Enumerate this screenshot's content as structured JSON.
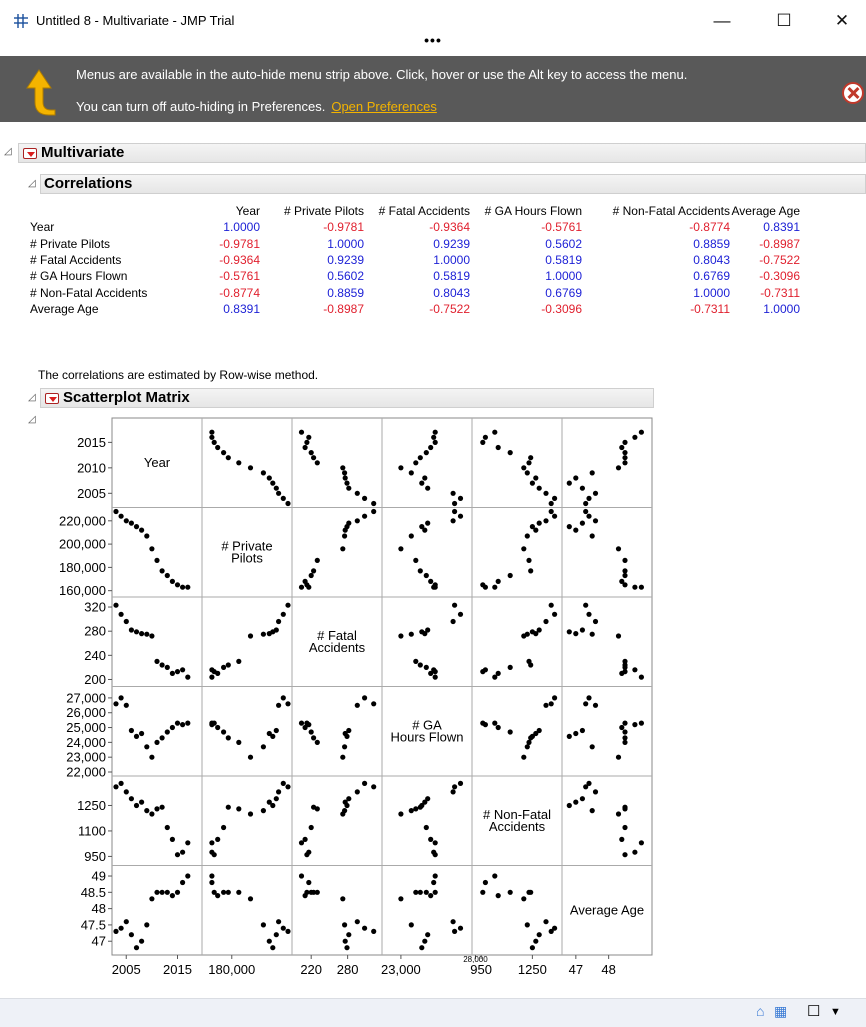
{
  "window": {
    "title": "Untitled 8 - Multivariate - JMP Trial",
    "minimize": "—",
    "maximize": "☐",
    "close": "✕",
    "overflow": "•••"
  },
  "banner": {
    "line1": "Menus are available in the auto-hide menu strip above. Click, hover or use the Alt key to access the menu.",
    "line2": "You can turn off auto-hiding in Preferences.",
    "link": "Open Preferences"
  },
  "report": {
    "title": "Multivariate",
    "correlations": {
      "title": "Correlations",
      "columns": [
        "Year",
        "# Private Pilots",
        "# Fatal Accidents",
        "# GA Hours Flown",
        "# Non-Fatal Accidents",
        "Average Age"
      ],
      "rows": [
        {
          "label": "Year",
          "values": [
            "1.0000",
            "-0.9781",
            "-0.9364",
            "-0.5761",
            "-0.8774",
            "0.8391"
          ]
        },
        {
          "label": "# Private Pilots",
          "values": [
            "-0.9781",
            "1.0000",
            "0.9239",
            "0.5602",
            "0.8859",
            "-0.8987"
          ]
        },
        {
          "label": "# Fatal Accidents",
          "values": [
            "-0.9364",
            "0.9239",
            "1.0000",
            "0.5819",
            "0.8043",
            "-0.7522"
          ]
        },
        {
          "label": "# GA Hours Flown",
          "values": [
            "-0.5761",
            "0.5602",
            "0.5819",
            "1.0000",
            "0.6769",
            "-0.3096"
          ]
        },
        {
          "label": "# Non-Fatal Accidents",
          "values": [
            "-0.8774",
            "0.8859",
            "0.8043",
            "0.6769",
            "1.0000",
            "-0.7311"
          ]
        },
        {
          "label": "Average Age",
          "values": [
            "0.8391",
            "-0.8987",
            "-0.7522",
            "-0.3096",
            "-0.7311",
            "1.0000"
          ]
        }
      ],
      "note": "The correlations are estimated by Row-wise method."
    },
    "scatterplot": {
      "title": "Scatterplot Matrix",
      "diagonal_labels": [
        [
          "Year"
        ],
        [
          "# Private",
          "Pilots"
        ],
        [
          "# Fatal",
          "Accidents"
        ],
        [
          "# GA",
          "Hours Flown"
        ],
        [
          "# Non-Fatal",
          "Accidents"
        ],
        [
          "Average Age"
        ]
      ],
      "y_ticks": [
        [
          {
            "v": 2015,
            "t": "2015"
          },
          {
            "v": 2010,
            "t": "2010"
          },
          {
            "v": 2005,
            "t": "2005"
          }
        ],
        [
          {
            "v": 220000,
            "t": "220,000"
          },
          {
            "v": 200000,
            "t": "200,000"
          },
          {
            "v": 180000,
            "t": "180,000"
          },
          {
            "v": 160000,
            "t": "160,000"
          }
        ],
        [
          {
            "v": 320,
            "t": "320"
          },
          {
            "v": 280,
            "t": "280"
          },
          {
            "v": 240,
            "t": "240"
          },
          {
            "v": 200,
            "t": "200"
          }
        ],
        [
          {
            "v": 27000,
            "t": "27,000"
          },
          {
            "v": 26000,
            "t": "26,000"
          },
          {
            "v": 25000,
            "t": "25,000"
          },
          {
            "v": 24000,
            "t": "24,000"
          },
          {
            "v": 23000,
            "t": "23,000"
          },
          {
            "v": 22000,
            "t": "22,000"
          }
        ],
        [
          {
            "v": 1250,
            "t": "1250"
          },
          {
            "v": 1100,
            "t": "1100"
          },
          {
            "v": 950,
            "t": "950"
          }
        ],
        [
          {
            "v": 49,
            "t": "49"
          },
          {
            "v": 48.5,
            "t": "48.5"
          },
          {
            "v": 48,
            "t": "48"
          },
          {
            "v": 47.5,
            "t": "47.5"
          },
          {
            "v": 47,
            "t": "47"
          }
        ]
      ],
      "x_ticks": [
        [
          {
            "v": 2005,
            "t": "2005"
          },
          {
            "v": 2015,
            "t": "2015"
          }
        ],
        [
          {
            "v": 180000,
            "t": "180,000"
          }
        ],
        [
          {
            "v": 220,
            "t": "220"
          },
          {
            "v": 280,
            "t": "280"
          }
        ],
        [
          {
            "v": 23000,
            "t": "23,000"
          },
          {
            "v": 28000,
            "t": "28,000"
          }
        ],
        [
          {
            "v": 950,
            "t": "950"
          },
          {
            "v": 1250,
            "t": "1250"
          }
        ],
        [
          {
            "v": 47,
            "t": "47"
          },
          {
            "v": 48,
            "t": "48"
          }
        ]
      ]
    }
  },
  "chart_data": {
    "type": "scatter",
    "title": "Scatterplot Matrix",
    "variables": [
      "Year",
      "# Private Pilots",
      "# Fatal Accidents",
      "# GA Hours Flown",
      "# Non-Fatal Accidents",
      "Average Age"
    ],
    "ranges": [
      [
        2003,
        2019
      ],
      [
        158000,
        228000
      ],
      [
        195,
        330
      ],
      [
        22000,
        27500
      ],
      [
        920,
        1400
      ],
      [
        46.7,
        49.2
      ]
    ],
    "observations": [
      [
        2003,
        228000,
        323,
        26600,
        1360,
        47.3
      ],
      [
        2004,
        224000,
        308,
        27000,
        1380,
        47.4
      ],
      [
        2005,
        220000,
        296,
        26500,
        1330,
        47.6
      ],
      [
        2006,
        218000,
        282,
        24800,
        1290,
        47.2
      ],
      [
        2007,
        215000,
        279,
        24400,
        1250,
        46.8
      ],
      [
        2008,
        212000,
        276,
        24600,
        1270,
        47.0
      ],
      [
        2009,
        207000,
        275,
        23700,
        1220,
        47.5
      ],
      [
        2010,
        196000,
        272,
        23000,
        1200,
        48.3
      ],
      [
        2011,
        186000,
        230,
        24000,
        1230,
        48.5
      ],
      [
        2012,
        177000,
        224,
        24300,
        1240,
        48.5
      ],
      [
        2013,
        173000,
        220,
        24700,
        1120,
        48.5
      ],
      [
        2014,
        168000,
        210,
        25000,
        1050,
        48.4
      ],
      [
        2015,
        165000,
        213,
        25300,
        960,
        48.5
      ],
      [
        2016,
        163000,
        216,
        25200,
        975,
        48.8
      ],
      [
        2017,
        163000,
        204,
        25300,
        1030,
        49.0
      ]
    ]
  },
  "status": {
    "home_icon": "⌂",
    "grid_icon": "▦",
    "box_icon": "☐",
    "down_icon": "▼"
  }
}
